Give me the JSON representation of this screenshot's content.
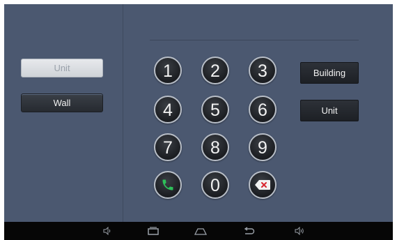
{
  "left_panel": {
    "unit_button": "Unit",
    "wall_button": "Wall"
  },
  "keypad": {
    "keys": [
      "1",
      "2",
      "3",
      "4",
      "5",
      "6",
      "7",
      "8",
      "9",
      "0"
    ],
    "call_icon": "phone-call-icon",
    "delete_icon": "backspace-icon"
  },
  "actions": {
    "building_button": "Building",
    "unit_button": "Unit"
  },
  "navbar": {
    "icons": [
      "volume-down-icon",
      "recent-apps-icon",
      "home-icon",
      "back-icon",
      "volume-up-icon"
    ]
  },
  "colors": {
    "background": "#4b5870",
    "call_green": "#2ec05a",
    "delete_red": "#d8262f"
  }
}
